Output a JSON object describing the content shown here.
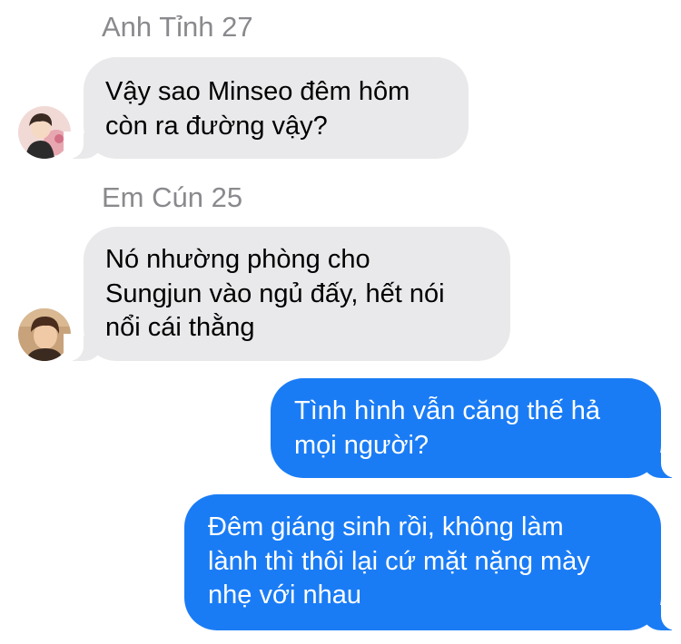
{
  "messages": [
    {
      "sender": "Anh Tỉnh 27",
      "text": "Vậy sao Minseo đêm hôm\ncòn ra đường vậy?",
      "direction": "incoming",
      "avatar_icon": "user-avatar-photo"
    },
    {
      "sender": "Em Cún 25",
      "text": "Nó nhường phòng cho\nSungjun vào ngủ đấy, hết nói\nnổi cái thằng",
      "direction": "incoming",
      "avatar_icon": "user-avatar-photo"
    },
    {
      "text": "Tình hình vẫn căng thế hả\nmọi người?",
      "direction": "outgoing"
    },
    {
      "text": "Đêm giáng sinh rồi, không làm\nlành thì thôi lại cứ mặt nặng mày\nnhẹ với nhau",
      "direction": "outgoing"
    }
  ],
  "colors": {
    "incoming_bubble": "#e9e9eb",
    "outgoing_bubble": "#1a7cf5",
    "sender_name": "#8a8a8e"
  }
}
